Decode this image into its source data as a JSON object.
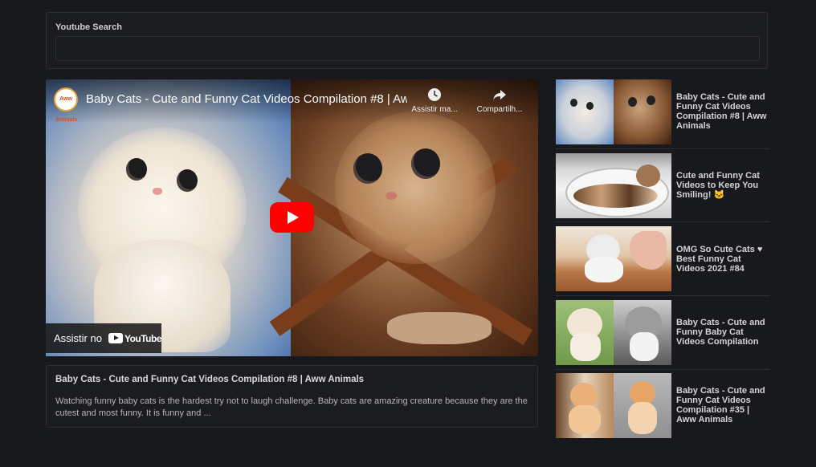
{
  "search": {
    "label": "Youtube Search",
    "value": "",
    "placeholder": ""
  },
  "player": {
    "title": "Baby Cats - Cute and Funny Cat Videos Compilation #8 | Aww Animals",
    "channel_logo_text": "Aww Animals",
    "watch_later_label": "Assistir ma...",
    "share_label": "Compartilh...",
    "watch_on_label": "Assistir no",
    "youtube_wordmark": "YouTube"
  },
  "description": {
    "title": "Baby Cats - Cute and Funny Cat Videos Compilation #8 | Aww Animals",
    "text": "Watching funny baby cats is the hardest try not to laugh challenge. Baby cats are amazing creature because they are the cutest and most funny. It is funny and ..."
  },
  "related": [
    {
      "title": "Baby Cats - Cute and Funny Cat Videos Compilation #8 | Aww Animals"
    },
    {
      "title": "Cute and Funny Cat Videos to Keep You Smiling! 🐱"
    },
    {
      "title": "OMG So Cute Cats ♥ Best Funny Cat Videos 2021 #84"
    },
    {
      "title": "Baby Cats - Cute and Funny Baby Cat Videos Compilation"
    },
    {
      "title": "Baby Cats - Cute and Funny Cat Videos Compilation #35 | Aww Animals"
    }
  ],
  "colors": {
    "background": "#18191c",
    "play_button": "#ff0000"
  }
}
